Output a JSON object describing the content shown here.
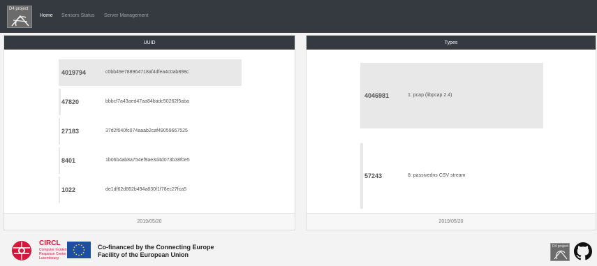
{
  "navbar": {
    "brand": "D4 project",
    "links": [
      {
        "label": "Home",
        "active": true
      },
      {
        "label": "Sensors Status",
        "active": false
      },
      {
        "label": "Server Management",
        "active": false
      }
    ]
  },
  "uuid_card": {
    "header": "UUID",
    "rows": [
      {
        "count": "4019794",
        "uuid": "c0bb49e788964718af4dfea4c0ab898c",
        "fill": 1.0
      },
      {
        "count": "47820",
        "uuid": "bbbcf7a43aed47aa84badc50262f5aba",
        "fill": 0.012
      },
      {
        "count": "27183",
        "uuid": "37d2f040fc074aaab2caf49059667525",
        "fill": 0.007
      },
      {
        "count": "8401",
        "uuid": "1b06b4ab8a754ef9ae3d4d073b38f0e5",
        "fill": 0.002
      },
      {
        "count": "1022",
        "uuid": "de1df62d862b494a830f1f78ec27fca5",
        "fill": 0.0003
      }
    ],
    "footer": "2019/05/20"
  },
  "types_card": {
    "header": "Types",
    "rows": [
      {
        "count": "4046981",
        "type": "1: pcap (libpcap 2.4)",
        "fill": 1.0
      },
      {
        "count": "57243",
        "type": "8: passivedns CSV stream",
        "fill": 0.014
      }
    ],
    "footer": "2019/05/20"
  },
  "footer": {
    "circl_name": "CIRCL",
    "circl_sub": [
      "Computer Incident",
      "Response Center",
      "Luxembourg"
    ],
    "eu_line1": "Co-financed by the Connecting Europe",
    "eu_line2": "Facility of the European Union",
    "brand": "D4 project"
  },
  "colors": {
    "navbar": "#343a40",
    "bar": "#e8e8e8",
    "circl_red": "#d6163d",
    "eu_blue": "#1d4fa1",
    "eu_gold": "#ffd617"
  },
  "icons": [
    "d4-project-logo",
    "circl-logo",
    "eu-flag-icon",
    "github-icon"
  ]
}
